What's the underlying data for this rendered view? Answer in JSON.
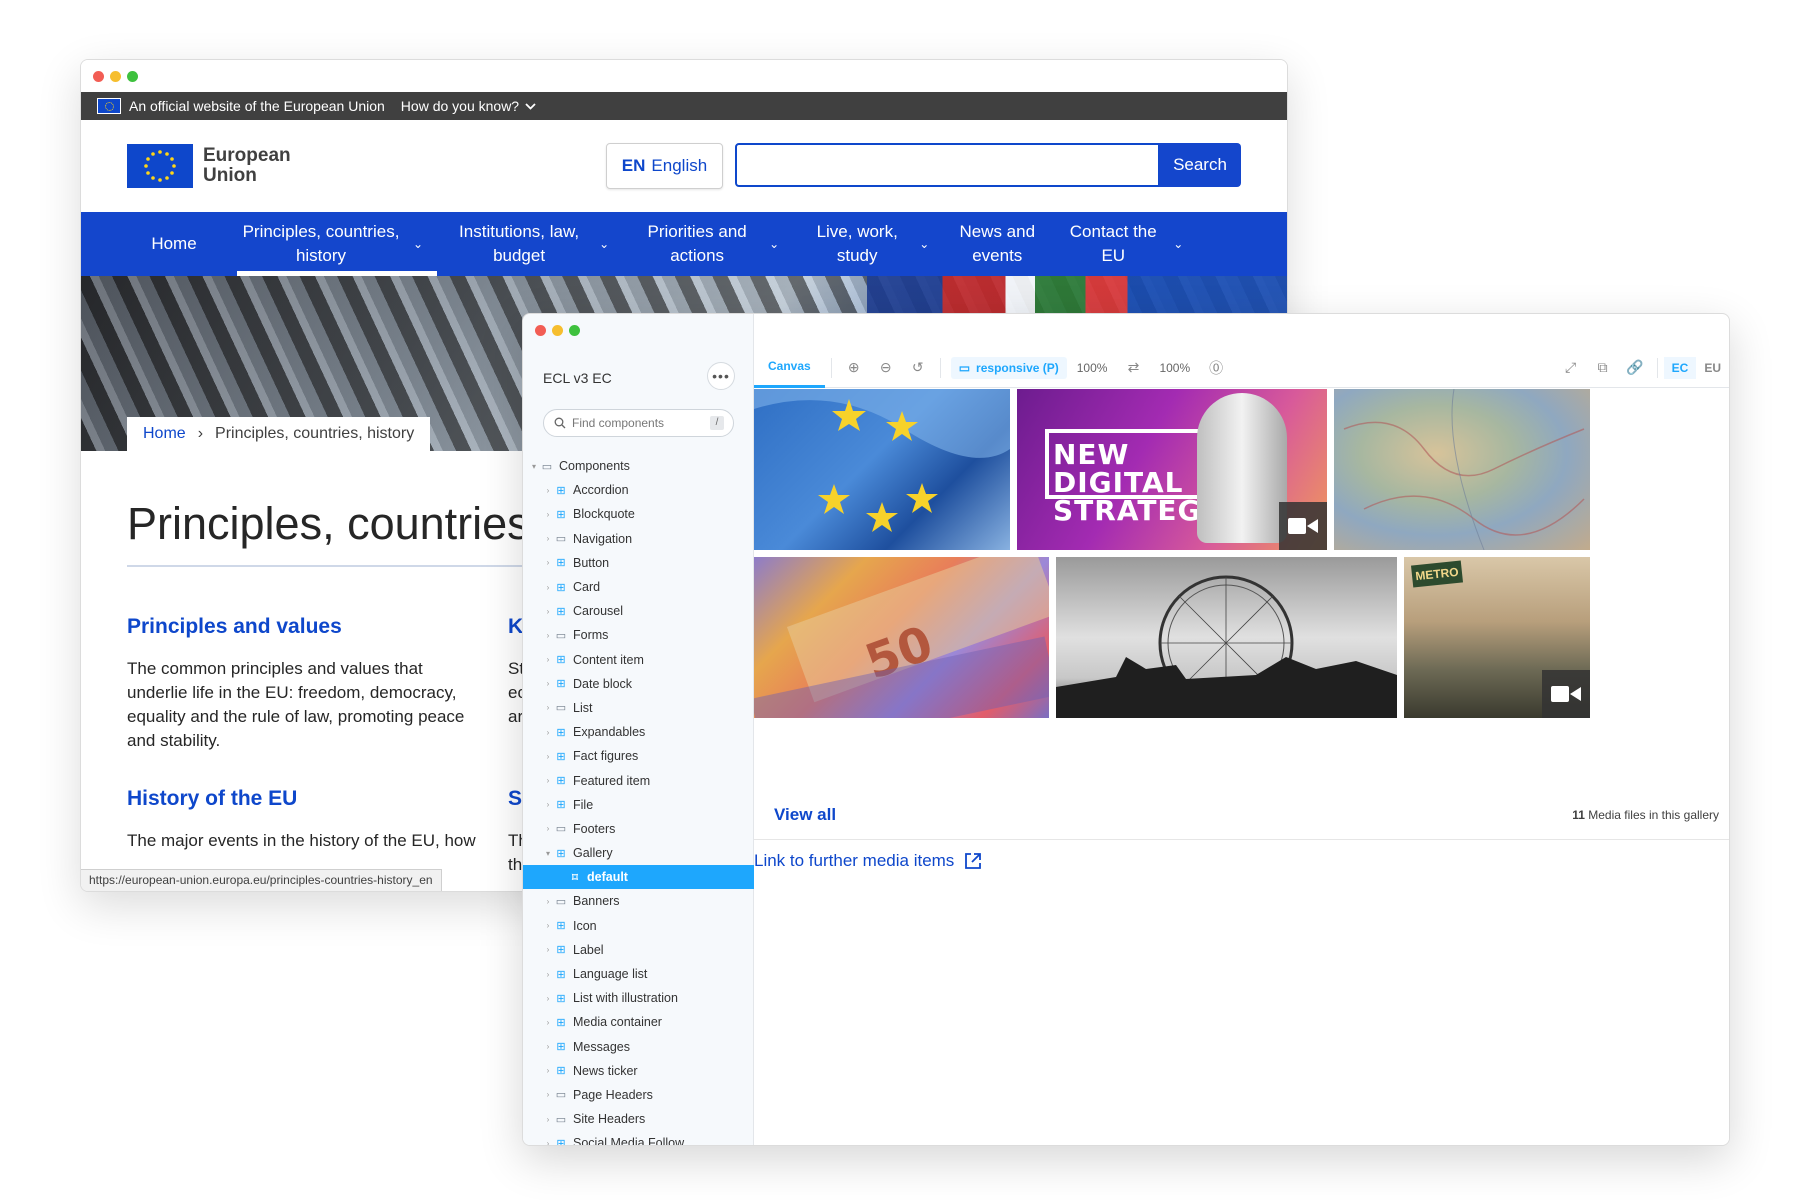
{
  "site": {
    "gov_bar": {
      "official_text": "An official website of the European Union",
      "how_text": "How do you know?"
    },
    "logo_text": "European Union",
    "language": {
      "code": "EN",
      "name": "English"
    },
    "search": {
      "value": "",
      "button_label": "Search"
    },
    "nav": [
      {
        "label": "Home",
        "dropdown": false,
        "active": false
      },
      {
        "label": "Principles, countries, history",
        "dropdown": true,
        "active": true
      },
      {
        "label": "Institutions, law, budget",
        "dropdown": true,
        "active": false
      },
      {
        "label": "Priorities and actions",
        "dropdown": true,
        "active": false
      },
      {
        "label": "Live, work, study",
        "dropdown": true,
        "active": false
      },
      {
        "label": "News and events",
        "dropdown": false,
        "active": false
      },
      {
        "label": "Contact the EU",
        "dropdown": true,
        "active": false
      }
    ],
    "breadcrumb": {
      "home": "Home",
      "current": "Principles, countries, history"
    },
    "page_title": "Principles, countries, history",
    "sections": [
      {
        "heading": "Principles and values",
        "text": "The common principles and values that underlie life in the EU: freedom, democracy, equality and the rule of law, promoting peace and stability."
      },
      {
        "heading": "History of the EU",
        "text": "The major events in the history of the EU, how"
      }
    ],
    "clipped_right": {
      "heading_1": "K",
      "text_1": [
        "St",
        "ec",
        "ar"
      ],
      "heading_2": "S",
      "text_2": [
        "Th",
        "th"
      ]
    },
    "status_url": "https://european-union.europa.eu/principles-countries-history_en"
  },
  "storybook": {
    "brand": "ECL v3 EC",
    "menu_icon": "ellipsis-icon",
    "find_placeholder": "Find components",
    "find_shortcut": "/",
    "tree": [
      {
        "label": "Components",
        "type": "folder",
        "level": 0,
        "expanded": true
      },
      {
        "label": "Accordion",
        "type": "component",
        "level": 1
      },
      {
        "label": "Blockquote",
        "type": "component",
        "level": 1
      },
      {
        "label": "Navigation",
        "type": "folder",
        "level": 1
      },
      {
        "label": "Button",
        "type": "component",
        "level": 1
      },
      {
        "label": "Card",
        "type": "component",
        "level": 1
      },
      {
        "label": "Carousel",
        "type": "component",
        "level": 1
      },
      {
        "label": "Forms",
        "type": "folder",
        "level": 1
      },
      {
        "label": "Content item",
        "type": "component",
        "level": 1
      },
      {
        "label": "Date block",
        "type": "component",
        "level": 1
      },
      {
        "label": "List",
        "type": "folder",
        "level": 1
      },
      {
        "label": "Expandables",
        "type": "component",
        "level": 1
      },
      {
        "label": "Fact figures",
        "type": "component",
        "level": 1
      },
      {
        "label": "Featured item",
        "type": "component",
        "level": 1
      },
      {
        "label": "File",
        "type": "component",
        "level": 1
      },
      {
        "label": "Footers",
        "type": "folder",
        "level": 1
      },
      {
        "label": "Gallery",
        "type": "component",
        "level": 1,
        "expanded": true
      },
      {
        "label": "default",
        "type": "story",
        "level": 2,
        "selected": true
      },
      {
        "label": "Banners",
        "type": "folder",
        "level": 1
      },
      {
        "label": "Icon",
        "type": "component",
        "level": 1
      },
      {
        "label": "Label",
        "type": "component",
        "level": 1
      },
      {
        "label": "Language list",
        "type": "component",
        "level": 1
      },
      {
        "label": "List with illustration",
        "type": "component",
        "level": 1
      },
      {
        "label": "Media container",
        "type": "component",
        "level": 1
      },
      {
        "label": "Messages",
        "type": "component",
        "level": 1
      },
      {
        "label": "News ticker",
        "type": "component",
        "level": 1
      },
      {
        "label": "Page Headers",
        "type": "folder",
        "level": 1
      },
      {
        "label": "Site Headers",
        "type": "folder",
        "level": 1
      },
      {
        "label": "Social Media Follow",
        "type": "component",
        "level": 1
      }
    ],
    "toolbar": {
      "canvas_tab": "Canvas",
      "viewport": "responsive (P)",
      "zoom_1": "100%",
      "zoom_2": "100%",
      "theme_ec": "EC",
      "theme_eu": "EU"
    },
    "gallery": {
      "digital_strategy_text": "NEW DIGITAL STRATEGY",
      "view_all": "View all",
      "count_number": "11",
      "count_text": "Media files in this gallery",
      "further_link": "Link to further media items"
    }
  },
  "colors": {
    "eu_blue": "#0e47cb",
    "nav_blue": "#1446cc",
    "storybook_accent": "#1ea7fd",
    "gov_bar": "#404040"
  }
}
